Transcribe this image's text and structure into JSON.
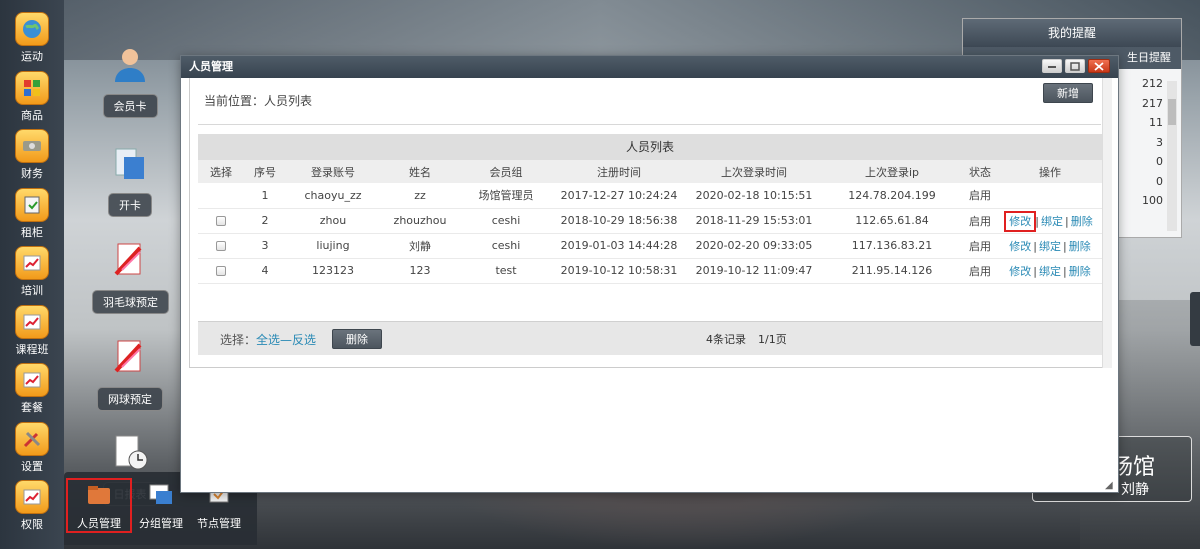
{
  "dock": [
    {
      "label": "运动",
      "icon": "globe-icon"
    },
    {
      "label": "商品",
      "icon": "shop-icon"
    },
    {
      "label": "财务",
      "icon": "money-icon"
    },
    {
      "label": "租柜",
      "icon": "locker-icon"
    },
    {
      "label": "培训",
      "icon": "chart-icon"
    },
    {
      "label": "课程班",
      "icon": "chart-icon"
    },
    {
      "label": "套餐",
      "icon": "chart-icon"
    },
    {
      "label": "设置",
      "icon": "tools-icon"
    },
    {
      "label": "权限",
      "icon": "chart-icon"
    }
  ],
  "desktop": [
    {
      "label": "会员卡",
      "icon": "person-icon"
    },
    {
      "label": "开卡",
      "icon": "card-icon"
    },
    {
      "label": "羽毛球预定",
      "icon": "booking-icon"
    },
    {
      "label": "网球预定",
      "icon": "booking-icon"
    },
    {
      "label": "日报表",
      "icon": "report-icon"
    }
  ],
  "reminder": {
    "title": "我的提醒",
    "subtitle": "生日提醒",
    "values": [
      "212",
      "217",
      "11",
      "3",
      "0",
      "0",
      "100"
    ]
  },
  "venue": {
    "name": "场馆",
    "user": "刘静"
  },
  "taskbar": [
    {
      "label": "人员管理",
      "icon": "folder-icon",
      "active": true
    },
    {
      "label": "分组管理",
      "icon": "group-icon",
      "active": false
    },
    {
      "label": "节点管理",
      "icon": "node-icon",
      "active": false
    }
  ],
  "window": {
    "title": "人员管理",
    "breadcrumb": "当前位置：人员列表",
    "add_button": "新增",
    "table_title": "人员列表",
    "columns": [
      "选择",
      "序号",
      "登录账号",
      "姓名",
      "会员组",
      "注册时间",
      "上次登录时间",
      "上次登录ip",
      "状态",
      "操作"
    ],
    "rows": [
      {
        "has_checkbox": false,
        "index": "1",
        "account": "chaoyu_zz",
        "name": "zz",
        "group": "场馆管理员",
        "registered": "2017-12-27 10:24:24",
        "last_login": "2020-02-18 10:15:51",
        "ip": "124.78.204.199",
        "status": "启用",
        "ops": []
      },
      {
        "has_checkbox": true,
        "index": "2",
        "account": "zhou",
        "name": "zhouzhou",
        "group": "ceshi",
        "registered": "2018-10-29 18:56:38",
        "last_login": "2018-11-29 15:53:01",
        "ip": "112.65.61.84",
        "status": "启用",
        "ops": [
          "修改",
          "绑定",
          "删除"
        ]
      },
      {
        "has_checkbox": true,
        "index": "3",
        "account": "liujing",
        "name": "刘静",
        "group": "ceshi",
        "registered": "2019-01-03 14:44:28",
        "last_login": "2020-02-20 09:33:05",
        "ip": "117.136.83.21",
        "status": "启用",
        "ops": [
          "修改",
          "绑定",
          "删除"
        ]
      },
      {
        "has_checkbox": true,
        "index": "4",
        "account": "123123",
        "name": "123",
        "group": "test",
        "registered": "2019-10-12 10:58:31",
        "last_login": "2019-10-12 11:09:47",
        "ip": "211.95.14.126",
        "status": "启用",
        "ops": [
          "修改",
          "绑定",
          "删除"
        ]
      }
    ],
    "footer": {
      "select_label": "选择：",
      "select_all": "全选",
      "dash": "—",
      "invert": "反选",
      "delete_button": "删除",
      "count": "4条记录",
      "pages": "1/1页"
    },
    "separator": "|"
  },
  "colors": {
    "accent_link": "#2a8ab5",
    "highlight_red": "#e02020"
  }
}
